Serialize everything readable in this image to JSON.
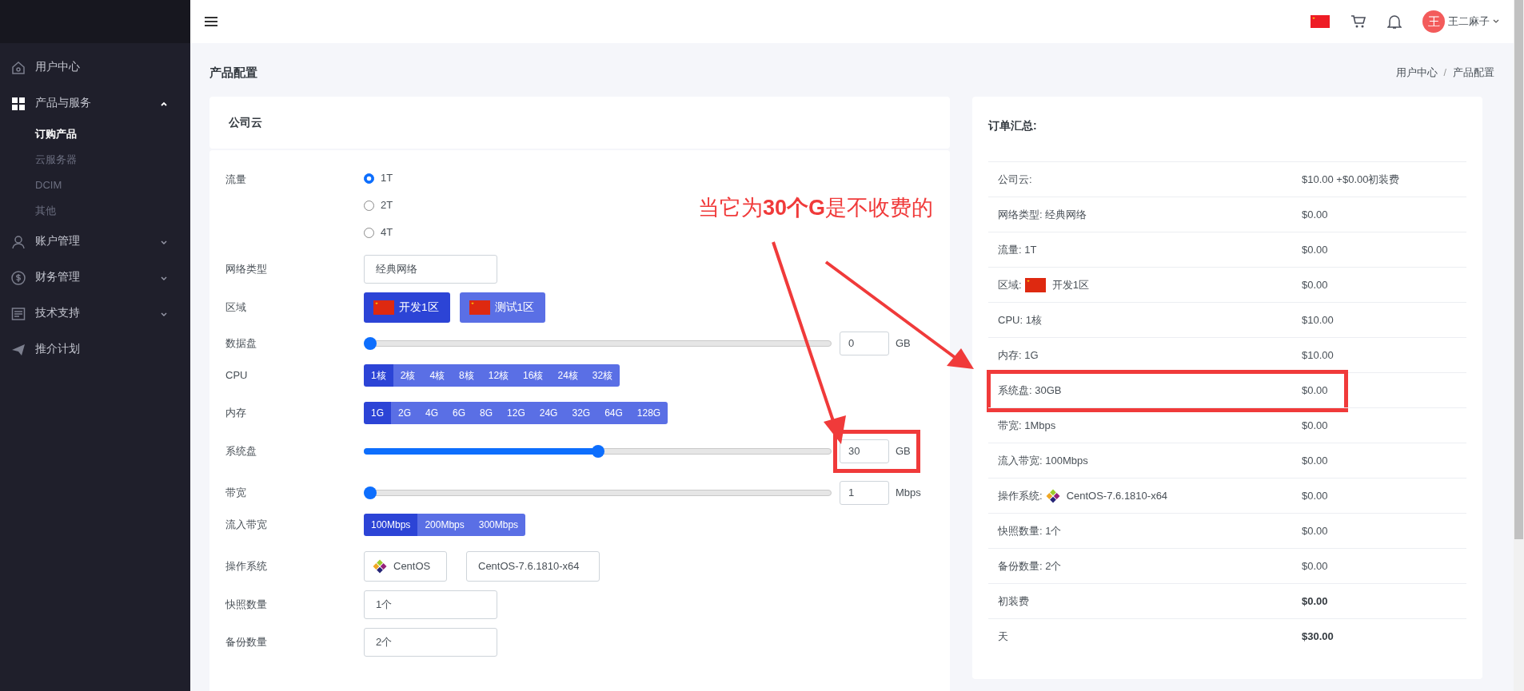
{
  "sidebar": {
    "items": [
      {
        "label": "用户中心"
      },
      {
        "label": "产品与服务",
        "expanded": true,
        "children": [
          {
            "label": "订购产品",
            "selected": true
          },
          {
            "label": "云服务器",
            "selected": false
          },
          {
            "label": "DCIM",
            "selected": false
          },
          {
            "label": "其他",
            "selected": false
          }
        ]
      },
      {
        "label": "账户管理",
        "expanded": false
      },
      {
        "label": "财务管理",
        "expanded": false
      },
      {
        "label": "技术支持",
        "expanded": false
      },
      {
        "label": "推介计划"
      }
    ]
  },
  "header": {
    "avatar": "王",
    "user_name": "王二麻子"
  },
  "page_title": "产品配置",
  "breadcrumb": [
    "用户中心",
    "产品配置"
  ],
  "breadcrumb_separator": "/",
  "form": {
    "title": "公司云",
    "rows": [
      {
        "kind": "radio",
        "label": "流量",
        "options": [
          {
            "label": "1T",
            "selected": true
          },
          {
            "label": "2T",
            "selected": false
          },
          {
            "label": "4T",
            "selected": false
          }
        ]
      },
      {
        "kind": "input",
        "label": "网络类型",
        "value": "经典网络"
      },
      {
        "kind": "region",
        "label": "区域",
        "options": [
          {
            "label": "开发1区",
            "selected": true
          },
          {
            "label": "测试1区",
            "selected": false
          }
        ]
      },
      {
        "kind": "slider",
        "label": "数据盘",
        "level": 0,
        "value": "0",
        "unit": "GB",
        "highlighted": false
      },
      {
        "kind": "segmented",
        "label": "CPU",
        "options": [
          {
            "label": "1核",
            "selected": true
          },
          {
            "label": "2核",
            "selected": false
          },
          {
            "label": "4核",
            "selected": false
          },
          {
            "label": "8核",
            "selected": false
          },
          {
            "label": "12核",
            "selected": false
          },
          {
            "label": "16核",
            "selected": false
          },
          {
            "label": "24核",
            "selected": false
          },
          {
            "label": "32核",
            "selected": false
          }
        ]
      },
      {
        "kind": "segmented",
        "label": "内存",
        "options": [
          {
            "label": "1G",
            "selected": true
          },
          {
            "label": "2G",
            "selected": false
          },
          {
            "label": "4G",
            "selected": false
          },
          {
            "label": "6G",
            "selected": false
          },
          {
            "label": "8G",
            "selected": false
          },
          {
            "label": "12G",
            "selected": false
          },
          {
            "label": "24G",
            "selected": false
          },
          {
            "label": "32G",
            "selected": false
          },
          {
            "label": "64G",
            "selected": false
          },
          {
            "label": "128G",
            "selected": false
          }
        ]
      },
      {
        "kind": "slider",
        "label": "系统盘",
        "level": 0.5,
        "value": "30",
        "unit": "GB",
        "highlighted": true
      },
      {
        "kind": "slider",
        "label": "带宽",
        "level": 0,
        "value": "1",
        "unit": "Mbps",
        "highlighted": false
      },
      {
        "kind": "segmented",
        "label": "流入带宽",
        "options": [
          {
            "label": "100Mbps",
            "selected": true
          },
          {
            "label": "200Mbps",
            "selected": false
          },
          {
            "label": "300Mbps",
            "selected": false
          }
        ]
      },
      {
        "kind": "os",
        "label": "操作系统",
        "os_name": "CentOS",
        "version": "CentOS-7.6.1810-x64"
      },
      {
        "kind": "input",
        "label": "快照数量",
        "value": "1个"
      },
      {
        "kind": "input",
        "label": "备份数量",
        "value": "2个"
      }
    ]
  },
  "summary": {
    "title": "订单汇总:",
    "rows": [
      {
        "kind": "plain",
        "label": "公司云:",
        "value": "$10.00 +$0.00初装费",
        "highlighted": false
      },
      {
        "kind": "plain",
        "label": "网络类型: 经典网络",
        "value": "$0.00",
        "highlighted": false
      },
      {
        "kind": "plain",
        "label": "流量: 1T",
        "value": "$0.00",
        "highlighted": false
      },
      {
        "kind": "flag",
        "label": "区域:",
        "text": "开发1区",
        "value": "$0.00",
        "highlighted": false
      },
      {
        "kind": "plain",
        "label": "CPU: 1核",
        "value": "$10.00",
        "highlighted": false
      },
      {
        "kind": "plain",
        "label": "内存: 1G",
        "value": "$10.00",
        "highlighted": false
      },
      {
        "kind": "plain",
        "label": "系统盘: 30GB",
        "value": "$0.00",
        "highlighted": true
      },
      {
        "kind": "plain",
        "label": "带宽: 1Mbps",
        "value": "$0.00",
        "highlighted": false
      },
      {
        "kind": "plain",
        "label": "流入带宽: 100Mbps",
        "value": "$0.00",
        "highlighted": false
      },
      {
        "kind": "os",
        "label": "操作系统:",
        "text": "CentOS-7.6.1810-x64",
        "value": "$0.00",
        "highlighted": false
      },
      {
        "kind": "plain",
        "label": "快照数量: 1个",
        "value": "$0.00",
        "highlighted": false
      },
      {
        "kind": "plain",
        "label": "备份数量: 2个",
        "value": "$0.00",
        "highlighted": false
      },
      {
        "kind": "total",
        "label": "初装费",
        "value": "$0.00",
        "highlighted": false
      },
      {
        "kind": "total",
        "label": "天",
        "value": "$30.00",
        "highlighted": false
      }
    ]
  },
  "annotation": {
    "text": "当它为**30个G**是不收费的"
  }
}
